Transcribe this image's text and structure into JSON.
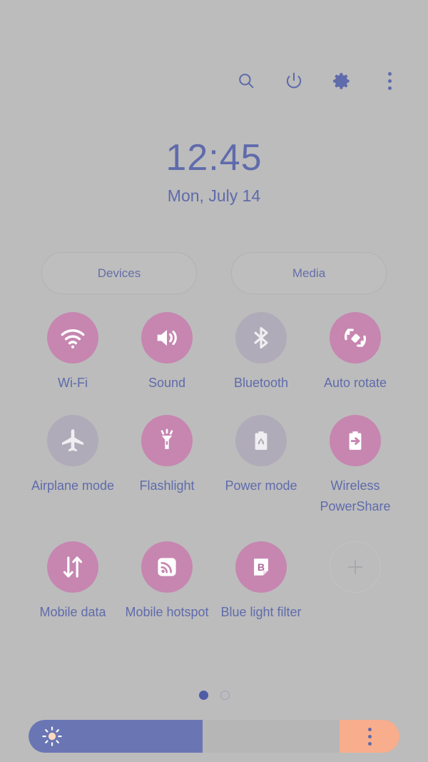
{
  "statusbar": {
    "icons": [
      {
        "name": "search-icon",
        "label": "Search"
      },
      {
        "name": "power-icon",
        "label": "Power off"
      },
      {
        "name": "gear-icon",
        "label": "Settings"
      },
      {
        "name": "more-options-icon",
        "label": "More options"
      }
    ]
  },
  "clock": {
    "time": "12:45",
    "date": "Mon, July 14"
  },
  "shortcuts": {
    "devices_label": "Devices",
    "media_label": "Media"
  },
  "toggles": [
    {
      "label": "Wi-Fi",
      "icon": "wifi-icon",
      "state": "on"
    },
    {
      "label": "Sound",
      "icon": "sound-icon",
      "state": "on"
    },
    {
      "label": "Bluetooth",
      "icon": "bluetooth-icon",
      "state": "off"
    },
    {
      "label": "Auto rotate",
      "icon": "auto-rotate-icon",
      "state": "on"
    },
    {
      "label": "Airplane mode",
      "icon": "airplane-icon",
      "state": "off"
    },
    {
      "label": "Flashlight",
      "icon": "flashlight-icon",
      "state": "on"
    },
    {
      "label": "Power mode",
      "icon": "power-mode-icon",
      "state": "off"
    },
    {
      "label": "Wireless PowerShare",
      "icon": "wireless-powershare-icon",
      "state": "on"
    },
    {
      "label": "Mobile data",
      "icon": "mobile-data-icon",
      "state": "on"
    },
    {
      "label": "Mobile hotspot",
      "icon": "mobile-hotspot-icon",
      "state": "on"
    },
    {
      "label": "Blue light filter",
      "icon": "blue-light-filter-icon",
      "state": "on"
    },
    {
      "label": "",
      "icon": "add-icon",
      "state": "add"
    }
  ],
  "pagination": {
    "pages": 2,
    "active_page": 1
  },
  "brightness": {
    "value_percent": 47,
    "icon": "brightness-sun-icon",
    "menu_icon": "brightness-options-icon"
  },
  "colors": {
    "background": "#bcbcbc",
    "accent_blue": "#5f6bab",
    "toggle_on": "#c686b0",
    "toggle_off": "#b0abb8",
    "slider_fill": "#6a76b4",
    "slider_track": "#b6b6b6",
    "slider_cap": "#f8ad8d"
  }
}
